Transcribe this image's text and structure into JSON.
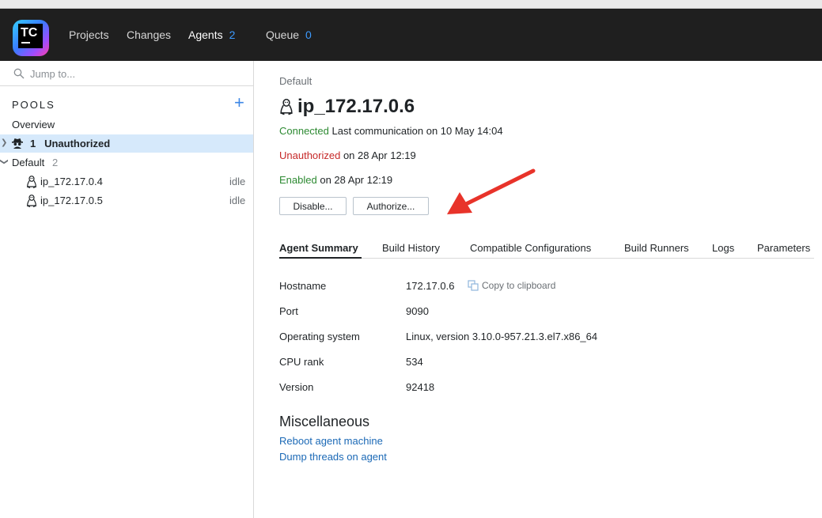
{
  "header": {
    "logo_text": "TC",
    "nav": [
      {
        "label": "Projects"
      },
      {
        "label": "Changes"
      },
      {
        "label": "Agents",
        "count": "2"
      },
      {
        "label": "Queue",
        "count": "0"
      }
    ]
  },
  "sidebar": {
    "search_placeholder": "Jump to...",
    "pools_heading": "POOLS",
    "add_icon": "plus-icon",
    "overview": "Overview",
    "unauthorized": {
      "count": "1",
      "label": "Unauthorized"
    },
    "default_pool": {
      "label": "Default",
      "count": "2"
    },
    "agents": [
      {
        "name": "ip_172.17.0.4",
        "status": "idle"
      },
      {
        "name": "ip_172.17.0.5",
        "status": "idle"
      }
    ]
  },
  "main": {
    "breadcrumb": "Default",
    "title": "ip_172.17.0.6",
    "connected": {
      "status": "Connected",
      "detail": "Last communication on 10 May 14:04"
    },
    "unauthorized": {
      "status": "Unauthorized",
      "detail": "on 28 Apr 12:19"
    },
    "enabled": {
      "status": "Enabled",
      "detail": "on 28 Apr 12:19"
    },
    "buttons": {
      "disable": "Disable...",
      "authorize": "Authorize..."
    },
    "tabs": [
      "Agent Summary",
      "Build History",
      "Compatible Configurations",
      "Build Runners",
      "Logs",
      "Parameters"
    ],
    "summary": [
      {
        "label": "Hostname",
        "value": "172.17.0.6"
      },
      {
        "label": "Port",
        "value": "9090"
      },
      {
        "label": "Operating system",
        "value": "Linux, version 3.10.0-957.21.3.el7.x86_64"
      },
      {
        "label": "CPU rank",
        "value": "534"
      },
      {
        "label": "Version",
        "value": "92418"
      }
    ],
    "copy_label": "Copy to clipboard",
    "misc_title": "Miscellaneous",
    "links": [
      "Reboot agent machine",
      "Dump threads on agent"
    ]
  },
  "colors": {
    "accent": "#3d9bff",
    "connected": "#2d8a32",
    "unauthorized": "#c62828",
    "link": "#1b69b6",
    "arrow": "#e8332a"
  }
}
